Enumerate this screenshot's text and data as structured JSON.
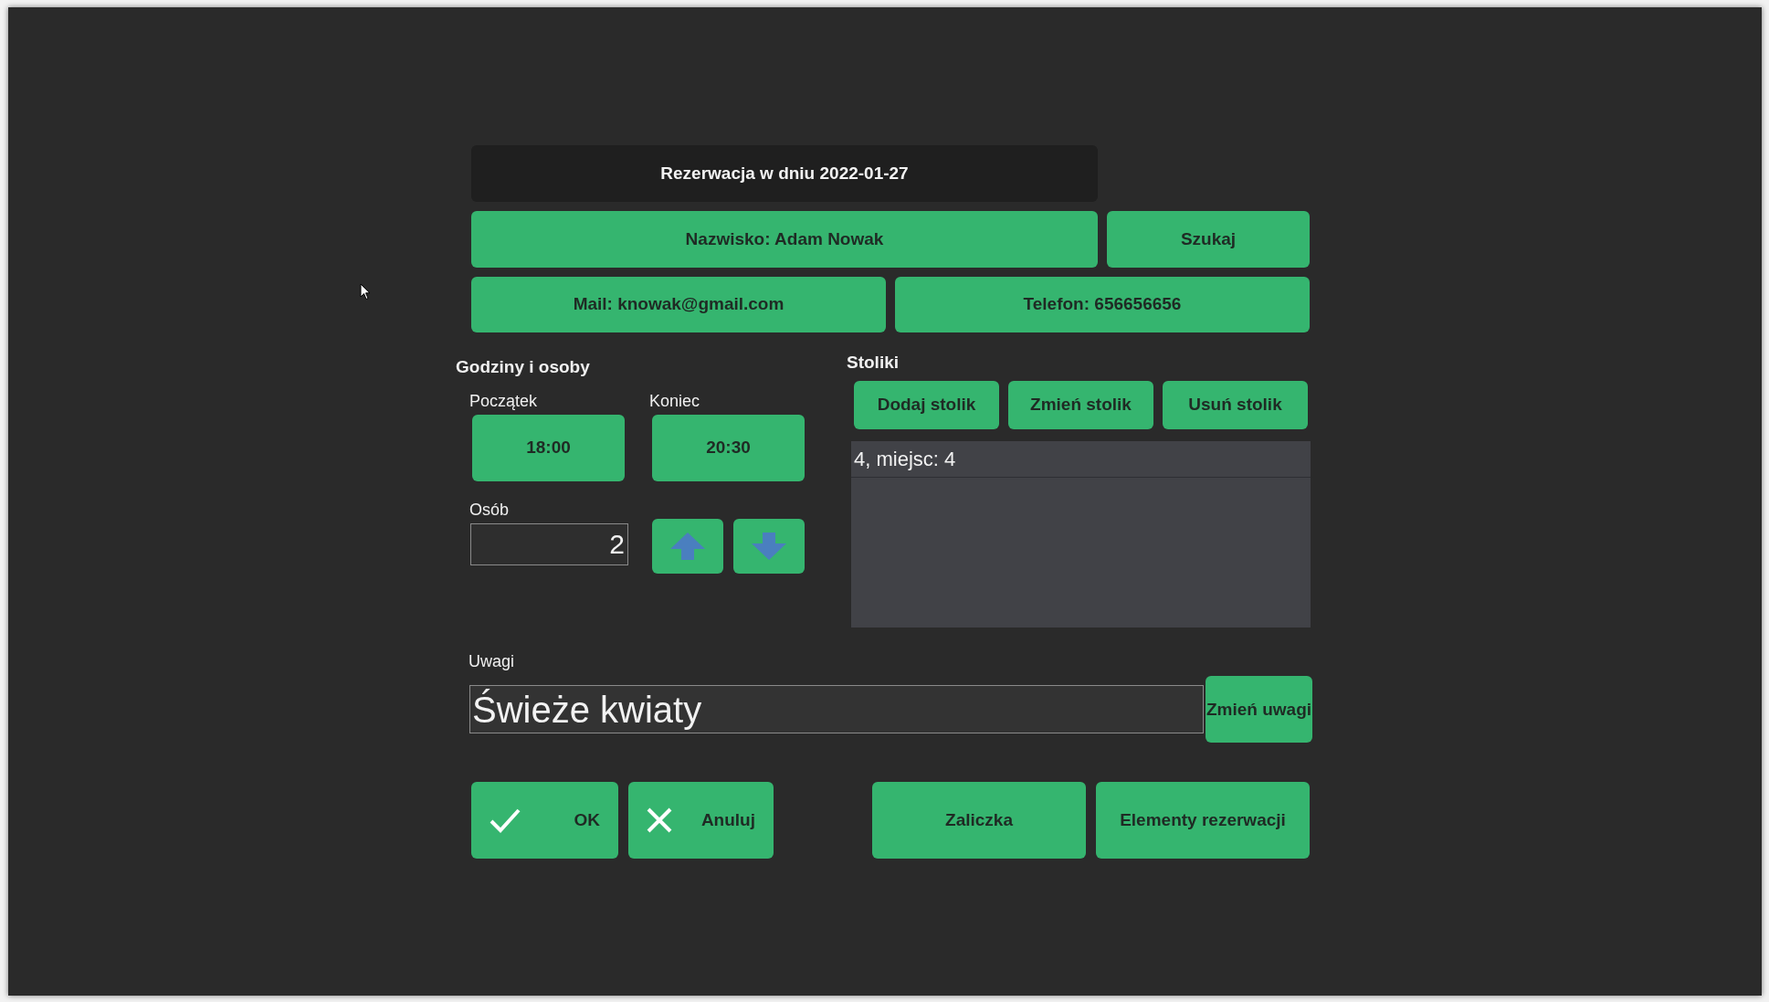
{
  "title": "Rezerwacja w dniu 2022-01-27",
  "customer": {
    "name_button": "Nazwisko: Adam Nowak",
    "search_button": "Szukaj",
    "mail_button": "Mail: knowak@gmail.com",
    "phone_button": "Telefon: 656656656"
  },
  "hours_people": {
    "heading": "Godziny i osoby",
    "start_label": "Początek",
    "start_button": "18:00",
    "end_label": "Koniec",
    "end_button": "20:30",
    "people_label": "Osób",
    "people_value": "2"
  },
  "tables": {
    "heading": "Stoliki",
    "buttons": [
      "Dodaj stolik",
      "Zmień stolik",
      "Usuń stolik"
    ],
    "rows": [
      {
        "text": "4, miejsc: 4"
      }
    ]
  },
  "notes": {
    "label": "Uwagi",
    "value": "Świeże kwiaty",
    "button": "Zmień uwagi"
  },
  "actions": [
    {
      "kind": "ok",
      "label": "OK"
    },
    {
      "kind": "cancel",
      "label": "Anuluj"
    },
    {
      "kind": "plain",
      "label": "Zaliczka"
    },
    {
      "kind": "plain",
      "label": "Elementy rezerwacji"
    }
  ]
}
